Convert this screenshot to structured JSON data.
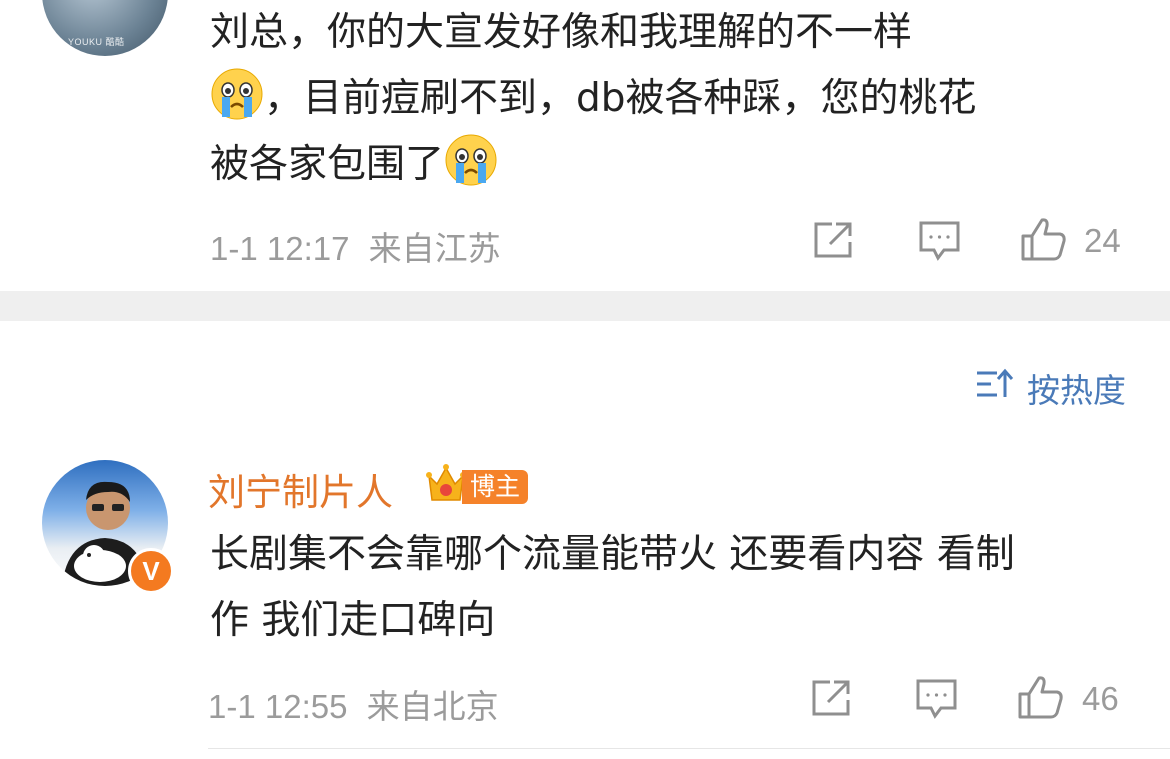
{
  "comment1": {
    "line1": "刘总，你的大宣发好像和我理解的不一样",
    "line2_after_emoji": "，目前痘刷不到，db被各种踩，您的桃花",
    "line3": "被各家包围了",
    "emoji": "crying-face",
    "avatar_watermark": "YOUKU 酷酷",
    "date": "1-1 12:17",
    "source": "来自江苏",
    "likes": "24"
  },
  "sort": {
    "label": "按热度"
  },
  "comment2": {
    "username": "刘宁制片人",
    "badge": "博主",
    "verified": "V",
    "line1": "长剧集不会靠哪个流量能带火 还要看内容 看制",
    "line2": "作 我们走口碑向",
    "date": "1-1 12:55",
    "source": "来自北京",
    "likes": "46"
  },
  "colors": {
    "username": "#e2762b",
    "meta": "#9b9b9b",
    "sort": "#4a7ab8",
    "badge": "#f5822a"
  }
}
